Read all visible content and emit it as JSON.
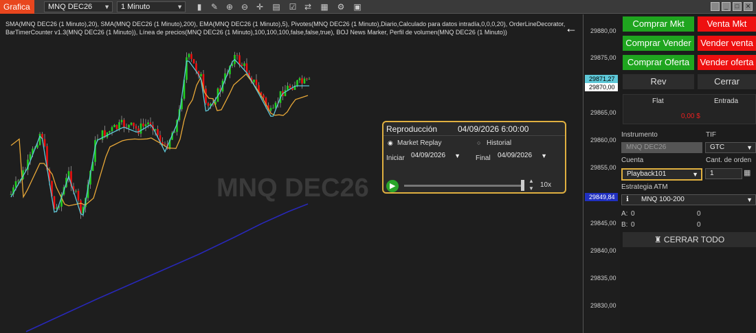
{
  "toolbar": {
    "app_tab": "Grafica",
    "instrument": "MNQ DEC26",
    "interval": "1 Minuto",
    "icons": [
      "bar-chart-icon",
      "pencil-icon",
      "zoom-in-icon",
      "zoom-out-icon",
      "crosshair-icon",
      "properties-icon",
      "data-box-icon",
      "strategy-icon",
      "indicators-icon",
      "strategies-icon",
      "templates-icon"
    ]
  },
  "chart": {
    "indicators_text": "SMA(MNQ DEC26 (1 Minuto),20), SMA(MNQ DEC26 (1 Minuto),200), EMA(MNQ DEC26 (1 Minuto),5), Pivotes(MNQ DEC26 (1 Minuto),Diario,Calculado para datos intradía,0,0,0,20), OrderLineDecorator, BarTimerCounter v1.3(MNQ DEC26 (1 Minuto)), Línea de precios(MNQ DEC26 (1 Minuto),100,100,100,false,false,true), BOJ News Marker, Perfil de volumen(MNQ DEC26 (1 Minuto))",
    "watermark": "MNQ DEC26",
    "axis_ticks": [
      "29880,00",
      "29875,00",
      "29870,00",
      "29865,00",
      "29860,00",
      "29855,00",
      "29850,00",
      "29845,00",
      "29840,00",
      "29835,00",
      "29830,00"
    ],
    "price_tags": {
      "cyan": "29871,27",
      "white": "29870,00",
      "blue": "29849,84"
    },
    "colors": {
      "up": "#22d022",
      "down": "#ee1010",
      "sma20": "#e8a838",
      "ema5": "#5ec8d8",
      "sma200": "#2828b8"
    }
  },
  "replay": {
    "title": "Reproducción",
    "datetime": "04/09/2026 6:00:00",
    "option_market": "Market Replay",
    "option_history": "Historial",
    "start_label": "Iniciar",
    "start_date": "04/09/2026",
    "end_label": "Final",
    "end_date": "04/09/2026",
    "speed": "10x"
  },
  "panel": {
    "buy_mkt": "Comprar Mkt",
    "sell_mkt": "Venta Mkt",
    "buy_ask": "Comprar Vender",
    "sell_ask": "Vender venta",
    "buy_bid": "Comprar Oferta",
    "sell_bid": "Vender oferta",
    "rev": "Rev",
    "close": "Cerrar",
    "flat": "Flat",
    "entry": "Entrada",
    "pnl": "0,00 $",
    "instrument_label": "Instrumento",
    "instrument_value": "MNQ DEC26",
    "tif_label": "TIF",
    "tif_value": "GTC",
    "account_label": "Cuenta",
    "account_value": "Playback101",
    "qty_label": "Cant. de orden",
    "qty_value": "1",
    "atm_label": "Estrategia ATM",
    "atm_value": "MNQ 100-200",
    "a_label": "A:",
    "a_val1": "0",
    "a_val2": "0",
    "b_label": "B:",
    "b_val1": "0",
    "b_val2": "0",
    "close_all": "CERRAR TODO"
  }
}
